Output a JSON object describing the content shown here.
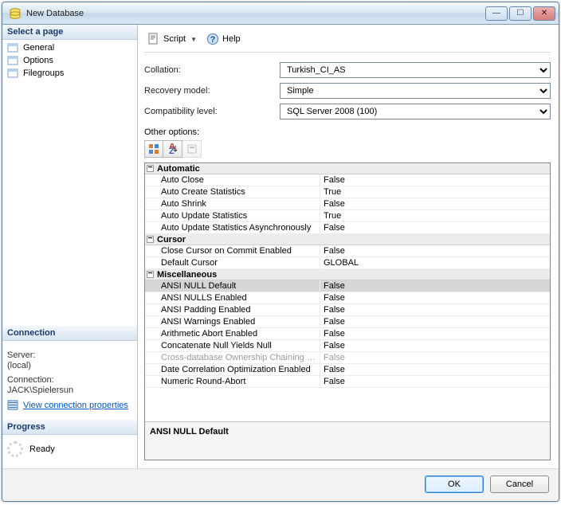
{
  "window": {
    "title": "New Database"
  },
  "left": {
    "select_page": "Select a page",
    "pages": [
      "General",
      "Options",
      "Filegroups"
    ],
    "connection_hdr": "Connection",
    "server_lbl": "Server:",
    "server_val": "(local)",
    "connection_lbl": "Connection:",
    "connection_val": "JACK\\Spielersun",
    "view_conn": "View connection properties",
    "progress_hdr": "Progress",
    "progress_state": "Ready"
  },
  "toolbar": {
    "script": "Script",
    "help": "Help"
  },
  "form": {
    "collation_lbl": "Collation:",
    "collation_val": "Turkish_CI_AS",
    "recovery_lbl": "Recovery model:",
    "recovery_val": "Simple",
    "compat_lbl": "Compatibility level:",
    "compat_val": "SQL Server 2008 (100)",
    "other_lbl": "Other options:"
  },
  "grid": {
    "categories": [
      {
        "name": "Automatic",
        "rows": [
          {
            "name": "Auto Close",
            "value": "False"
          },
          {
            "name": "Auto Create Statistics",
            "value": "True"
          },
          {
            "name": "Auto Shrink",
            "value": "False"
          },
          {
            "name": "Auto Update Statistics",
            "value": "True"
          },
          {
            "name": "Auto Update Statistics Asynchronously",
            "value": "False"
          }
        ]
      },
      {
        "name": "Cursor",
        "rows": [
          {
            "name": "Close Cursor on Commit Enabled",
            "value": "False"
          },
          {
            "name": "Default Cursor",
            "value": "GLOBAL"
          }
        ]
      },
      {
        "name": "Miscellaneous",
        "rows": [
          {
            "name": "ANSI NULL Default",
            "value": "False",
            "selected": true
          },
          {
            "name": "ANSI NULLS Enabled",
            "value": "False"
          },
          {
            "name": "ANSI Padding Enabled",
            "value": "False"
          },
          {
            "name": "ANSI Warnings Enabled",
            "value": "False"
          },
          {
            "name": "Arithmetic Abort Enabled",
            "value": "False"
          },
          {
            "name": "Concatenate Null Yields Null",
            "value": "False"
          },
          {
            "name": "Cross-database Ownership Chaining Enabled",
            "value": "False",
            "disabled": true
          },
          {
            "name": "Date Correlation Optimization Enabled",
            "value": "False"
          },
          {
            "name": "Numeric Round-Abort",
            "value": "False"
          }
        ]
      }
    ],
    "description_title": "ANSI NULL Default"
  },
  "footer": {
    "ok": "OK",
    "cancel": "Cancel"
  }
}
